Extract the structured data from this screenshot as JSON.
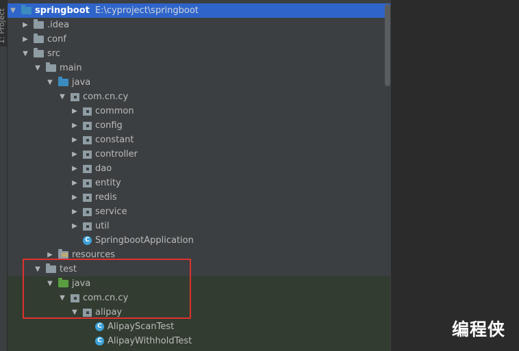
{
  "tool_window": {
    "tab_label": "1: Project"
  },
  "tree": [
    {
      "label": "springboot",
      "path": "E:\\cyproject\\springboot",
      "icon": "module-folder-icon",
      "arrow": "expanded",
      "selected": true,
      "bold": true,
      "indent": 0
    },
    {
      "label": ".idea",
      "icon": "folder-icon",
      "arrow": "collapsed",
      "indent": 1
    },
    {
      "label": "conf",
      "icon": "folder-icon",
      "arrow": "collapsed",
      "indent": 1
    },
    {
      "label": "src",
      "icon": "folder-icon",
      "arrow": "expanded",
      "indent": 1
    },
    {
      "label": "main",
      "icon": "folder-icon",
      "arrow": "expanded",
      "indent": 2
    },
    {
      "label": "java",
      "icon": "source-folder-icon",
      "arrow": "expanded",
      "indent": 3
    },
    {
      "label": "com.cn.cy",
      "icon": "package-icon",
      "arrow": "expanded",
      "indent": 4
    },
    {
      "label": "common",
      "icon": "package-icon",
      "arrow": "collapsed",
      "indent": 5
    },
    {
      "label": "config",
      "icon": "package-icon",
      "arrow": "collapsed",
      "indent": 5
    },
    {
      "label": "constant",
      "icon": "package-icon",
      "arrow": "collapsed",
      "indent": 5
    },
    {
      "label": "controller",
      "icon": "package-icon",
      "arrow": "collapsed",
      "indent": 5
    },
    {
      "label": "dao",
      "icon": "package-icon",
      "arrow": "collapsed",
      "indent": 5
    },
    {
      "label": "entity",
      "icon": "package-icon",
      "arrow": "collapsed",
      "indent": 5
    },
    {
      "label": "redis",
      "icon": "package-icon",
      "arrow": "collapsed",
      "indent": 5
    },
    {
      "label": "service",
      "icon": "package-icon",
      "arrow": "collapsed",
      "indent": 5
    },
    {
      "label": "util",
      "icon": "package-icon",
      "arrow": "collapsed",
      "indent": 5
    },
    {
      "label": "SpringbootApplication",
      "icon": "spring-class-icon",
      "arrow": "none",
      "indent": 5
    },
    {
      "label": "resources",
      "icon": "resources-folder-icon",
      "arrow": "collapsed",
      "indent": 3
    },
    {
      "label": "test",
      "icon": "folder-icon",
      "arrow": "expanded",
      "indent": 2
    },
    {
      "label": "java",
      "icon": "test-source-folder-icon",
      "arrow": "expanded",
      "indent": 3
    },
    {
      "label": "com.cn.cy",
      "icon": "package-icon",
      "arrow": "expanded",
      "indent": 4
    },
    {
      "label": "alipay",
      "icon": "package-icon",
      "arrow": "expanded",
      "indent": 5
    },
    {
      "label": "AlipayScanTest",
      "icon": "test-class-icon",
      "arrow": "none",
      "indent": 6
    },
    {
      "label": "AlipayWithholdTest",
      "icon": "test-class-icon",
      "arrow": "none",
      "indent": 6
    }
  ],
  "watermark": "编程侠",
  "colors": {
    "selection": "#2f65ca",
    "highlight_box": "#e0312f",
    "test_background": "#323c30"
  }
}
